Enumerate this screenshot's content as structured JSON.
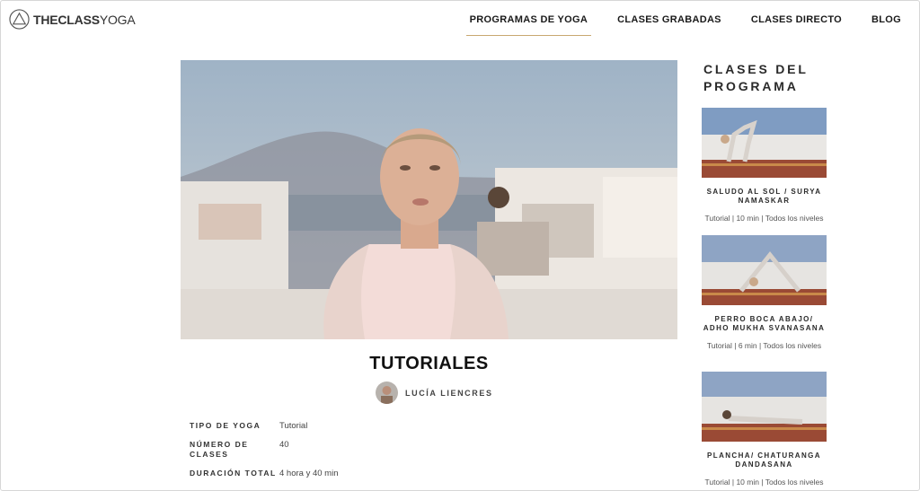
{
  "brand": {
    "name_bold": "THECLASS",
    "name_light": "YOGA"
  },
  "nav": {
    "items": [
      {
        "label": "PROGRAMAS DE YOGA",
        "active": true
      },
      {
        "label": "CLASES GRABADAS",
        "active": false
      },
      {
        "label": "CLASES DIRECTO",
        "active": false
      },
      {
        "label": "BLOG",
        "active": false
      }
    ]
  },
  "program": {
    "title": "TUTORIALES",
    "teacher": "LUCÍA LIENCRES",
    "details": [
      {
        "label": "TIPO DE YOGA",
        "value": "Tutorial"
      },
      {
        "label": "NÚMERO DE CLASES",
        "value": "40"
      },
      {
        "label": "DURACIÓN TOTAL",
        "value": "4 hora y 40 min"
      }
    ]
  },
  "sidebar": {
    "title": "CLASES DEL PROGRAMA",
    "classes": [
      {
        "title": "SALUDO AL SOL / SURYA NAMASKAR",
        "meta": "Tutorial | 10 min | Todos los niveles"
      },
      {
        "title": "PERRO BOCA ABAJO/ ADHO MUKHA SVANASANA",
        "meta": "Tutorial | 6 min | Todos los niveles"
      },
      {
        "title": "PLANCHA/ CHATURANGA DANDASANA",
        "meta": "Tutorial | 10 min | Todos los niveles"
      }
    ]
  },
  "colors": {
    "accent": "#c8a870",
    "text": "#1a1a1a",
    "mat": "#9a4a35"
  },
  "icons": {
    "logo": "triangle-circle-logo-icon"
  }
}
